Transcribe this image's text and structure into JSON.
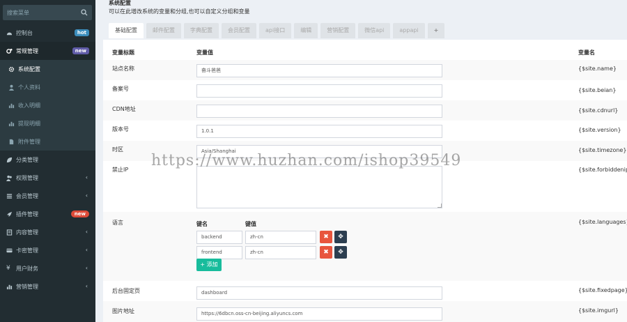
{
  "sidebar": {
    "search_placeholder": "搜索菜单",
    "items": [
      {
        "label": "控制台",
        "icon": "dashboard-icon",
        "badge": "hot"
      },
      {
        "label": "常规管理",
        "icon": "cogs-icon",
        "badge": "new"
      },
      {
        "label": "系统配置",
        "icon": "gear-icon"
      },
      {
        "label": "个人资料",
        "icon": "user-icon"
      },
      {
        "label": "收入明细",
        "icon": "bar-chart-icon"
      },
      {
        "label": "提现明细",
        "icon": "bar-chart-icon"
      },
      {
        "label": "附件管理",
        "icon": "file-icon"
      },
      {
        "label": "分类管理",
        "icon": "leaf-icon"
      },
      {
        "label": "权限管理",
        "icon": "group-icon",
        "chevron": "‹"
      },
      {
        "label": "会员管理",
        "icon": "list-icon",
        "chevron": "‹"
      },
      {
        "label": "插件管理",
        "icon": "rocket-icon",
        "badge": "new"
      },
      {
        "label": "内容管理",
        "icon": "book-icon",
        "chevron": "‹"
      },
      {
        "label": "卡密管理",
        "icon": "card-icon",
        "chevron": "‹"
      },
      {
        "label": "用户财务",
        "icon": "yen-icon",
        "chevron": "‹"
      },
      {
        "label": "营销管理",
        "icon": "chart-icon",
        "chevron": "‹"
      }
    ]
  },
  "header": {
    "title": "系统配置",
    "description": "可以在此增改系统的变量和分组,也可以自定义分组和变量"
  },
  "tabs": [
    "基础配置",
    "邮件配置",
    "字典配置",
    "会员配置",
    "api接口",
    "编辑",
    "营销配置",
    "微信api",
    "appapi",
    "+"
  ],
  "table": {
    "col_title": "变量标题",
    "col_value": "变量值",
    "col_name": "变量名"
  },
  "rows": [
    {
      "label": "站点名称",
      "value": "奋斗爸爸",
      "var": "{$site.name}"
    },
    {
      "label": "备案号",
      "value": "",
      "var": "{$site.beian}"
    },
    {
      "label": "CDN地址",
      "value": "",
      "var": "{$site.cdnurl}"
    },
    {
      "label": "版本号",
      "value": "1.0.1",
      "var": "{$site.version}"
    },
    {
      "label": "时区",
      "value": "Asia/Shanghai",
      "var": "{$site.timezone}"
    },
    {
      "label": "禁止IP",
      "value": "",
      "var": "{$site.forbiddenip}"
    },
    {
      "label": "语言",
      "var": "{$site.languages}"
    },
    {
      "label": "后台固定页",
      "value": "dashboard",
      "var": "{$site.fixedpage}"
    },
    {
      "label": "图片地址",
      "value": "https://6dbcn.oss-cn-beijing.aliyuncs.com",
      "var": "{$site.imgurl}"
    }
  ],
  "languages": {
    "key_header": "键名",
    "value_header": "键值",
    "entries": [
      {
        "key": "backend",
        "value": "zh-cn"
      },
      {
        "key": "frontend",
        "value": "zh-cn"
      }
    ],
    "add_label": "+ 添加",
    "delete_symbol": "✖",
    "move_symbol": "✥"
  },
  "watermark": "https://www.huzhan.com/ishop39549",
  "colors": {
    "sidebar_bg": "#222d32",
    "accent_green": "#18bc9c",
    "delete_red": "#e8553e",
    "badge_blue": "#3c8dbc",
    "badge_purple": "#605ca8",
    "badge_red": "#dd4b39"
  }
}
